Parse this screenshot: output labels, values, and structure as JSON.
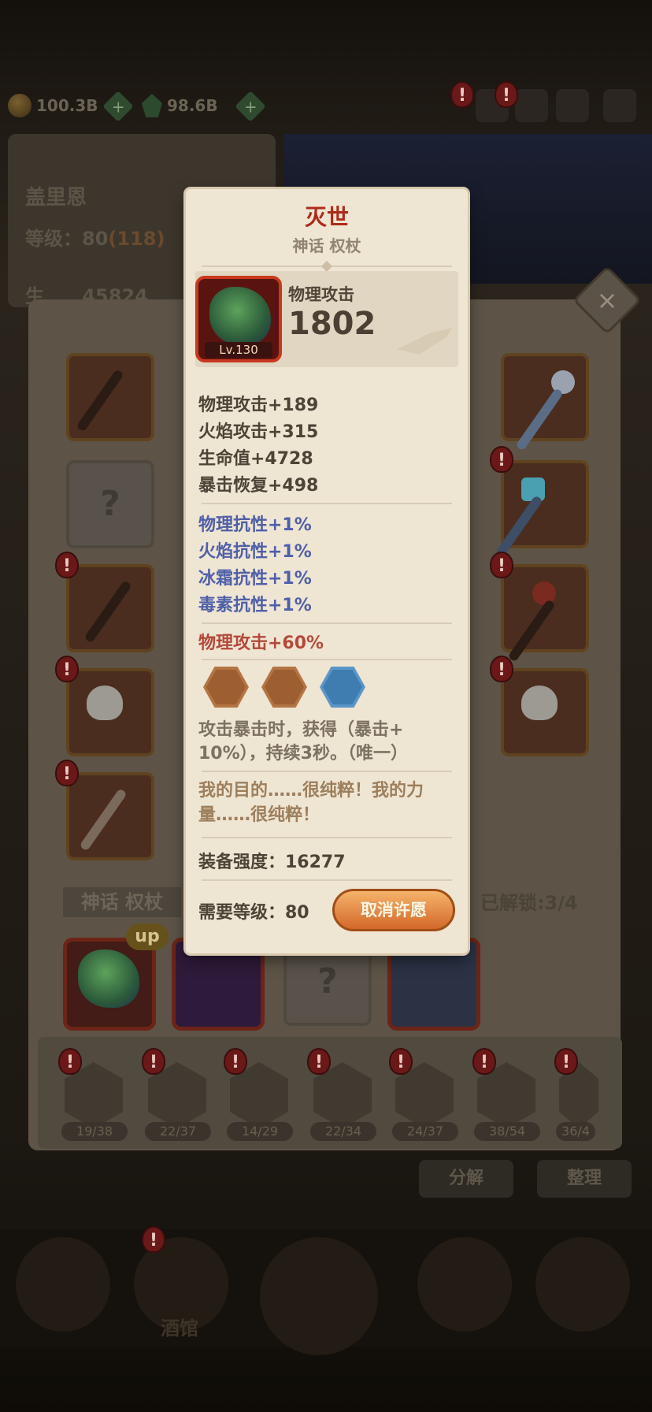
{
  "topbar": {
    "gold": "100.3B",
    "gems": "98.6B"
  },
  "character": {
    "name": "盖里恩",
    "level_label": "等级：80",
    "level_bonus": "(118)",
    "power_prefix": "生",
    "power_value": "45824"
  },
  "inventory": {
    "section_label": "神话 权杖",
    "unlocked": "已解锁:3/4",
    "empty_glyph": "?",
    "up_badge": "up"
  },
  "tabs": [
    {
      "count": "19/38"
    },
    {
      "count": "22/37"
    },
    {
      "count": "14/29"
    },
    {
      "count": "22/34"
    },
    {
      "count": "24/37"
    },
    {
      "count": "38/54"
    },
    {
      "count": "36/4"
    }
  ],
  "actions": {
    "decompose": "分解",
    "organize": "整理"
  },
  "nav": {
    "tavern": "酒馆"
  },
  "item": {
    "name": "灭世",
    "category": "神话 权杖",
    "level_tag": "Lv.130",
    "main_stat_label": "物理攻击",
    "main_stat_value": "1802",
    "base_stats": [
      "物理攻击+189",
      "火焰攻击+315",
      "生命值+4728",
      "暴击恢复+498"
    ],
    "resist_stats": [
      "物理抗性+1%",
      "火焰抗性+1%",
      "冰霜抗性+1%",
      "毒素抗性+1%"
    ],
    "bonus_stat": "物理攻击+60%",
    "sockets": [
      "bronze",
      "bronze",
      "blue"
    ],
    "effect_line1": "攻击暴击时，获得（暴击+",
    "effect_line2": "10%），持续3秒。（唯一）",
    "quote_line1": "我的目的……很纯粹！我的力",
    "quote_line2": "量……很纯粹！",
    "strength": "装备强度：16277",
    "required_level": "需要等级：80",
    "cancel_wish": "取消许愿"
  },
  "colors": {
    "title_red": "#b02a1a",
    "resist_blue": "#4f5fa8",
    "bonus_red": "#b4493a",
    "button_orange": "#e08a3c",
    "parchment": "#efe5d3"
  },
  "icons": [
    "gold-coin-icon",
    "green-gem-icon",
    "mail-icon",
    "gear-icon",
    "close-icon",
    "dragon-staff-icon"
  ]
}
